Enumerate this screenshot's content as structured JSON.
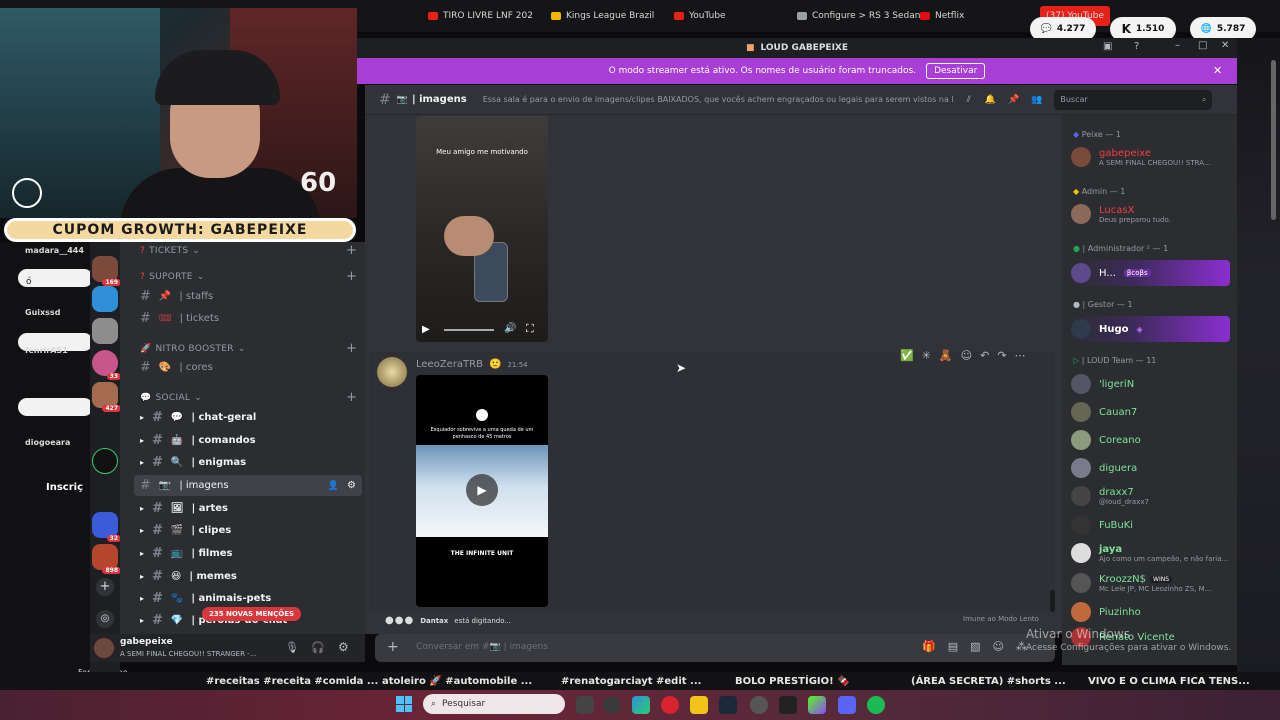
{
  "browser": {
    "tabs": [
      "TIRO LIVRE LNF 202",
      "Kings League Brazil",
      "YouTube",
      "Configure > RS 3 Sedan",
      "Netflix",
      "(37) YouTube"
    ],
    "tab_colors": [
      "#e62117",
      "#f2b705",
      "#e62117",
      "#9aa0a6",
      "#e50914",
      "#e62117"
    ],
    "stats": {
      "messages": "4.277",
      "kick": "1.510",
      "viewers": "5.787"
    }
  },
  "stream": {
    "timer": "60",
    "coupon": "CUPOM GROWTH: GABEPEIXE",
    "left_chatters": [
      "madara__444",
      "ó",
      "Guixssd",
      "fenrirAS1",
      "diogoeara",
      "Inscriç",
      "Fernandinho"
    ]
  },
  "window": {
    "title": "LOUD GABEPEIXE",
    "streamer_notice": "O modo streamer está ativo. Os nomes de usuário foram truncados.",
    "disable_button": "Desativar"
  },
  "channel_header": {
    "name": "| imagens",
    "topic": "Essa sala é para o envio de imagens/clipes BAIXADOS, que vocês achem engraçados ou legais para serem vistos na li...",
    "search_placeholder": "Buscar"
  },
  "server_rail": {
    "badges": [
      "169",
      "33",
      "427",
      "32",
      "898"
    ]
  },
  "sidebar": {
    "categories": [
      {
        "label": "TICKETS"
      },
      {
        "label": "SUPORTE"
      },
      {
        "label": "NITRO BOOSTER"
      },
      {
        "label": "SOCIAL"
      }
    ],
    "channels": [
      {
        "label": "| staffs"
      },
      {
        "label": "| tickets"
      },
      {
        "label": "| cores"
      },
      {
        "label": "| chat-geral"
      },
      {
        "label": "| comandos"
      },
      {
        "label": "| enigmas"
      },
      {
        "label": "| imagens"
      },
      {
        "label": "| artes"
      },
      {
        "label": "| clipes"
      },
      {
        "label": "| filmes"
      },
      {
        "label": "| memes"
      },
      {
        "label": "| animais-pets"
      },
      {
        "label": "| pérolas-do-chat"
      }
    ],
    "mentions_badge": "235 NOVAS MENÇÕES"
  },
  "user_panel": {
    "username": "gabepeixe",
    "status": "A SEMI FINAL CHEGOU!! STRANGER -..."
  },
  "messages": [
    {
      "video_caption": "Meu amigo me motivando"
    },
    {
      "author": "LeeoZeraTRB",
      "time": "21:54",
      "video_top_text": "Esquiador sobrevive a uma queda de um penhasco de 45 metros",
      "video_bottom_text": "THE INFINITE UNIT"
    }
  ],
  "typing": {
    "user": "Dantax",
    "text": "está digitando...",
    "slowmode": "Imune ao Modo Lento"
  },
  "composer": {
    "placeholder": "Conversar em #📷 | imagens"
  },
  "members": {
    "groups": [
      {
        "header": "Peixe — 1"
      },
      {
        "header": "Admin — 1"
      },
      {
        "header": "| Administrador ² — 1"
      },
      {
        "header": "| Gestor — 1"
      },
      {
        "header": "| LOUD Team — 11"
      }
    ],
    "list": [
      {
        "name": "gabepeixe",
        "sub": "A SEMI FINAL CHEGOU!! STRA...",
        "color": "#f23f43"
      },
      {
        "name": "LucasX",
        "sub": "Deus preparou tudo.",
        "color": "#f23f43"
      },
      {
        "name": "H...",
        "sub": "",
        "color": "#ffffff"
      },
      {
        "name": "Hugo",
        "sub": "",
        "color": "#ffffff"
      },
      {
        "name": "'ligeriN",
        "sub": "",
        "color": "#7fe39a"
      },
      {
        "name": "Cauan7",
        "sub": "",
        "color": "#7fe39a"
      },
      {
        "name": "Coreano",
        "sub": "",
        "color": "#7fe39a"
      },
      {
        "name": "diguera",
        "sub": "",
        "color": "#7fe39a"
      },
      {
        "name": "draxx7",
        "sub": "@loud_draxx7",
        "color": "#7fe39a"
      },
      {
        "name": "FuBuKi",
        "sub": "",
        "color": "#7fe39a"
      },
      {
        "name": "jaya",
        "sub": "Ajo como um campeão, e não faria...",
        "color": "#7fe39a"
      },
      {
        "name": "KroozzN$",
        "sub": "Mc Lele JP, MC Leozinho ZS, M...",
        "color": "#7fe39a"
      },
      {
        "name": "Piuzinho",
        "sub": "",
        "color": "#7fe39a"
      },
      {
        "name": "Renato Vicente",
        "sub": "",
        "color": "#7fe39a"
      }
    ],
    "win_badge": "WINS",
    "boost_badge": "βcoβs"
  },
  "windows_watermark": {
    "line1": "Ativar o Windows",
    "line2": "Acesse Configurações para ativar o Windows."
  },
  "ticker": [
    "#receitas #receita #comida ...",
    "atoleiro 🚀 #automobile ...",
    "#renatogarciayt #edit ...",
    "BOLO PRESTÍGIO! 🍫",
    "(ÁREA SECRETA) #shorts ...",
    "VIVO E O CLIMA FICA TENS..."
  ],
  "taskbar": {
    "search_placeholder": "Pesquisar"
  }
}
